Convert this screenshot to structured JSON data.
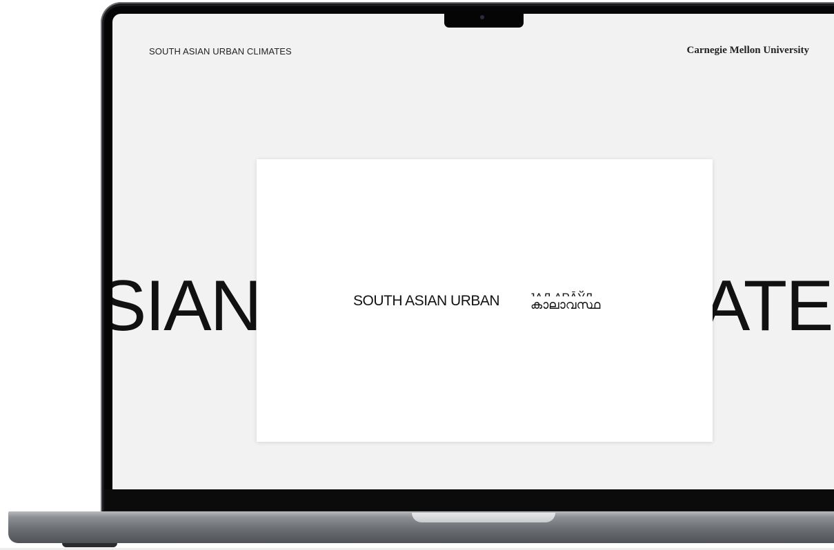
{
  "site": {
    "title": "SOUTH ASIAN URBAN CLIMATES",
    "logo": "Carnegie Mellon University"
  },
  "hero": {
    "left_fragment": "SIAN",
    "right_fragment": "ATE"
  },
  "card": {
    "title": "SOUTH ASIAN URBAN",
    "clipped_text": "ЈАЛ АРĀЎЛ",
    "script_text": "കാലാവസ്ഥ"
  },
  "colors": {
    "screen_background": "#f2f2f2",
    "card_background": "#ffffff",
    "text": "#111111",
    "laptop_body": "#1b1b1d"
  }
}
